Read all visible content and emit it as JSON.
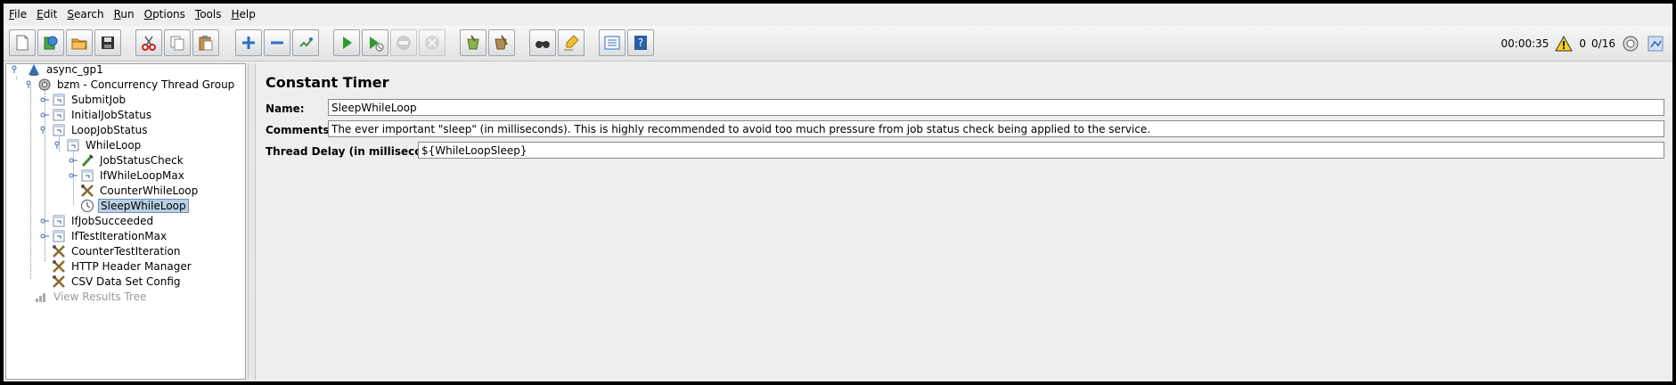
{
  "menu": [
    "File",
    "Edit",
    "Search",
    "Run",
    "Options",
    "Tools",
    "Help"
  ],
  "toolbar_buttons": [
    {
      "name": "new-icon"
    },
    {
      "name": "templates-icon"
    },
    {
      "name": "open-icon"
    },
    {
      "name": "save-icon"
    },
    {
      "name": "cut-icon"
    },
    {
      "name": "copy-icon"
    },
    {
      "name": "paste-icon"
    },
    {
      "name": "expand-icon"
    },
    {
      "name": "collapse-icon"
    },
    {
      "name": "toggle-icon"
    },
    {
      "name": "start-icon"
    },
    {
      "name": "start-no-pauses-icon"
    },
    {
      "name": "stop-icon"
    },
    {
      "name": "shutdown-icon"
    },
    {
      "name": "clear-icon"
    },
    {
      "name": "clear-all-icon"
    },
    {
      "name": "search-icon"
    },
    {
      "name": "reset-search-icon"
    },
    {
      "name": "function-helper-icon"
    },
    {
      "name": "help-icon"
    }
  ],
  "status": {
    "elapsed": "00:00:35",
    "warnings": "0",
    "threads": "0/16"
  },
  "tree": [
    {
      "label": "async_gp1",
      "icon": "test-plan-icon",
      "depth": 0,
      "toggle": "open"
    },
    {
      "label": "bzm - Concurrency Thread Group",
      "icon": "gear-icon",
      "depth": 1,
      "toggle": "open"
    },
    {
      "label": "SubmitJob",
      "icon": "controller-icon",
      "depth": 2,
      "toggle": "closed"
    },
    {
      "label": "InitialJobStatus",
      "icon": "controller-icon",
      "depth": 2,
      "toggle": "closed"
    },
    {
      "label": "LoopJobStatus",
      "icon": "controller-icon",
      "depth": 2,
      "toggle": "open"
    },
    {
      "label": "WhileLoop",
      "icon": "controller-icon",
      "depth": 3,
      "toggle": "open"
    },
    {
      "label": "JobStatusCheck",
      "icon": "sampler-icon",
      "depth": 4,
      "toggle": "closed"
    },
    {
      "label": "IfWhileLoopMax",
      "icon": "controller-icon",
      "depth": 4,
      "toggle": "closed"
    },
    {
      "label": "CounterWhileLoop",
      "icon": "config-icon",
      "depth": 4,
      "toggle": "none"
    },
    {
      "label": "SleepWhileLoop",
      "icon": "timer-icon",
      "depth": 4,
      "toggle": "none",
      "selected": true
    },
    {
      "label": "IfJobSucceeded",
      "icon": "controller-icon",
      "depth": 2,
      "toggle": "closed"
    },
    {
      "label": "IfTestIterationMax",
      "icon": "controller-icon",
      "depth": 2,
      "toggle": "closed"
    },
    {
      "label": "CounterTestIteration",
      "icon": "config-icon",
      "depth": 2,
      "toggle": "none"
    },
    {
      "label": "HTTP Header Manager",
      "icon": "config-icon",
      "depth": 2,
      "toggle": "none"
    },
    {
      "label": "CSV Data Set Config",
      "icon": "config-icon",
      "depth": 2,
      "toggle": "none"
    },
    {
      "label": "View Results Tree",
      "icon": "listener-icon",
      "depth": 1,
      "toggle": "none",
      "disabled": true
    }
  ],
  "panel": {
    "title": "Constant Timer",
    "name_label": "Name:",
    "name_value": "SleepWhileLoop",
    "comments_label": "Comments:",
    "comments_value": "The ever important \"sleep\" (in milliseconds). This is highly recommended to avoid too much pressure from job status check being applied to the service.",
    "delay_label": "Thread Delay (in milliseconds):",
    "delay_value": "${WhileLoopSleep}"
  }
}
